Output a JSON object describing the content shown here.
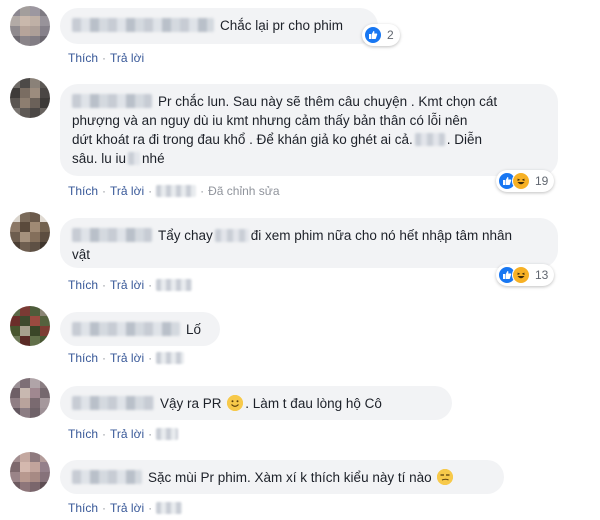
{
  "actions": {
    "like_label": "Thích",
    "reply_label": "Trả lời",
    "edited_label": "Đã chỉnh sửa"
  },
  "colors": {
    "link": "#385898",
    "bubble_bg": "#f2f3f5",
    "like_blue": "#1877f2",
    "haha_yellow": "#f7b125"
  },
  "comments": [
    {
      "text": "Chắc lại pr cho phim",
      "reaction_icons": [
        "like-icon"
      ],
      "reaction_count": "2"
    },
    {
      "text_line1": "Pr chắc lun. Sau này sẽ thêm câu chuyện . Kmt chọn cát",
      "text_line2": "phượng và an nguy dù iu kmt nhưng cảm thấy bản thân có lỗi nên",
      "text_line3": "dứt khoát ra đi trong đau khổ . Để khán giả ko ghét ai cả.",
      "text_line3_end": ". Diễn",
      "text_line4_a": "sâu. lu iu",
      "text_line4_b": "nhé",
      "reaction_icons": [
        "like-icon",
        "haha-icon"
      ],
      "reaction_count": "19",
      "edited": true
    },
    {
      "text_line1_a": "Tẩy chay",
      "text_line1_b": "đi xem phim nữa cho nó hết nhập tâm nhân",
      "text_line2": "vật",
      "reaction_icons": [
        "like-icon",
        "haha-icon"
      ],
      "reaction_count": "13"
    },
    {
      "text": "Lố"
    },
    {
      "text_a": "Vậy ra PR",
      "emoji": "smile-emoji",
      "text_b": ". Làm t đau lòng hộ Cô"
    },
    {
      "text": "Sặc mùi Pr phim. Xàm xí k thích kiểu này tí nào",
      "emoji": "unamused-emoji"
    }
  ]
}
